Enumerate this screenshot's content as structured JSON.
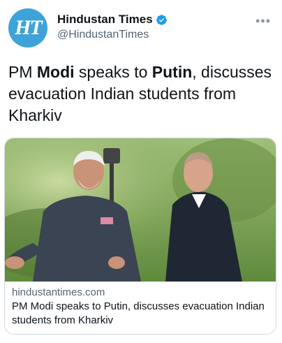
{
  "account": {
    "avatar_text": "HT",
    "display_name": "Hindustan Times",
    "handle": "@HindustanTimes",
    "verified": true,
    "avatar_color": "#3ea3d8",
    "verified_color": "#1d9bf0"
  },
  "tweet": {
    "text_parts": [
      "PM ",
      "Modi",
      " speaks to ",
      "Putin",
      ", discusses evacuation Indian students from Kharkiv"
    ]
  },
  "card": {
    "domain": "hindustantimes.com",
    "title": "PM Modi speaks to Putin, discusses evacuation Indian students from Kharkiv"
  },
  "icons": {
    "more": "more-horizontal-icon",
    "verified": "verified-badge-icon"
  }
}
